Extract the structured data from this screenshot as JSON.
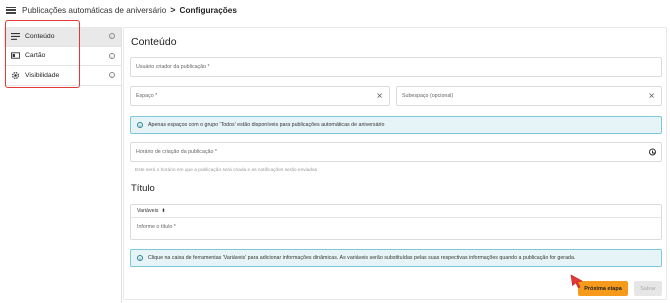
{
  "breadcrumb": {
    "parent": "Publicações automáticas de aniversário",
    "separator": ">",
    "current": "Configurações"
  },
  "sidebar": {
    "items": [
      {
        "label": "Conteúdo",
        "icon": "lines-icon",
        "active": true
      },
      {
        "label": "Cartão",
        "icon": "card-icon",
        "active": false
      },
      {
        "label": "Visibilidade",
        "icon": "gear-icon",
        "active": false
      }
    ],
    "highlight_color": "#e53935"
  },
  "main": {
    "title": "Conteúdo",
    "creator_label": "Usuário criador da publicação *",
    "space_label": "Espaço *",
    "subspace_label": "Subespaço (opcional)",
    "info_spaces": "Apenas espaços com o grupo 'Todos' estão disponíveis para publicações automáticas de aniversário",
    "time_label": "Horário de criação da publicação *",
    "time_hint": "Este será o horário em que a publicação será criada e as notificações serão enviadas",
    "title_section": "Título",
    "variables_label": "Variáveis",
    "title_placeholder": "Informe o título *",
    "info_variables": "Clique na caixa de ferramentas 'Variáveis' para adicionar informações dinâmicas. As variáveis serão substituídas pelas suas respectivas informações quando a publicação for gerada.",
    "info_color": "#e6f4f7"
  },
  "actions": {
    "next_label": "Próxima etapa",
    "save_label": "Salvar",
    "next_color": "#f59a1b"
  }
}
